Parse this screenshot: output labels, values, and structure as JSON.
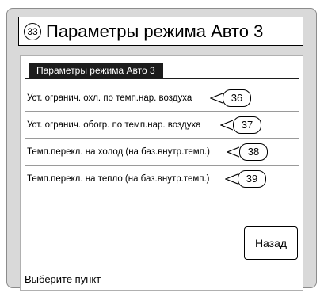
{
  "title": {
    "number": "33",
    "text": "Параметры режима Авто 3"
  },
  "screen": {
    "header": "Параметры режима Авто 3",
    "items": [
      {
        "label": "Уст. огранич. охл. по темп.нар. воздуха",
        "ref": "36"
      },
      {
        "label": "Уст. огранич. обогр. по темп.нар. воздуха",
        "ref": "37"
      },
      {
        "label": "Темп.перекл. на холод (на баз.внутр.темп.)",
        "ref": "38"
      },
      {
        "label": "Темп.перекл. на тепло (на баз.внутр.темп.)",
        "ref": "39"
      }
    ],
    "back_label": "Назад",
    "status": "Выберите пункт"
  }
}
